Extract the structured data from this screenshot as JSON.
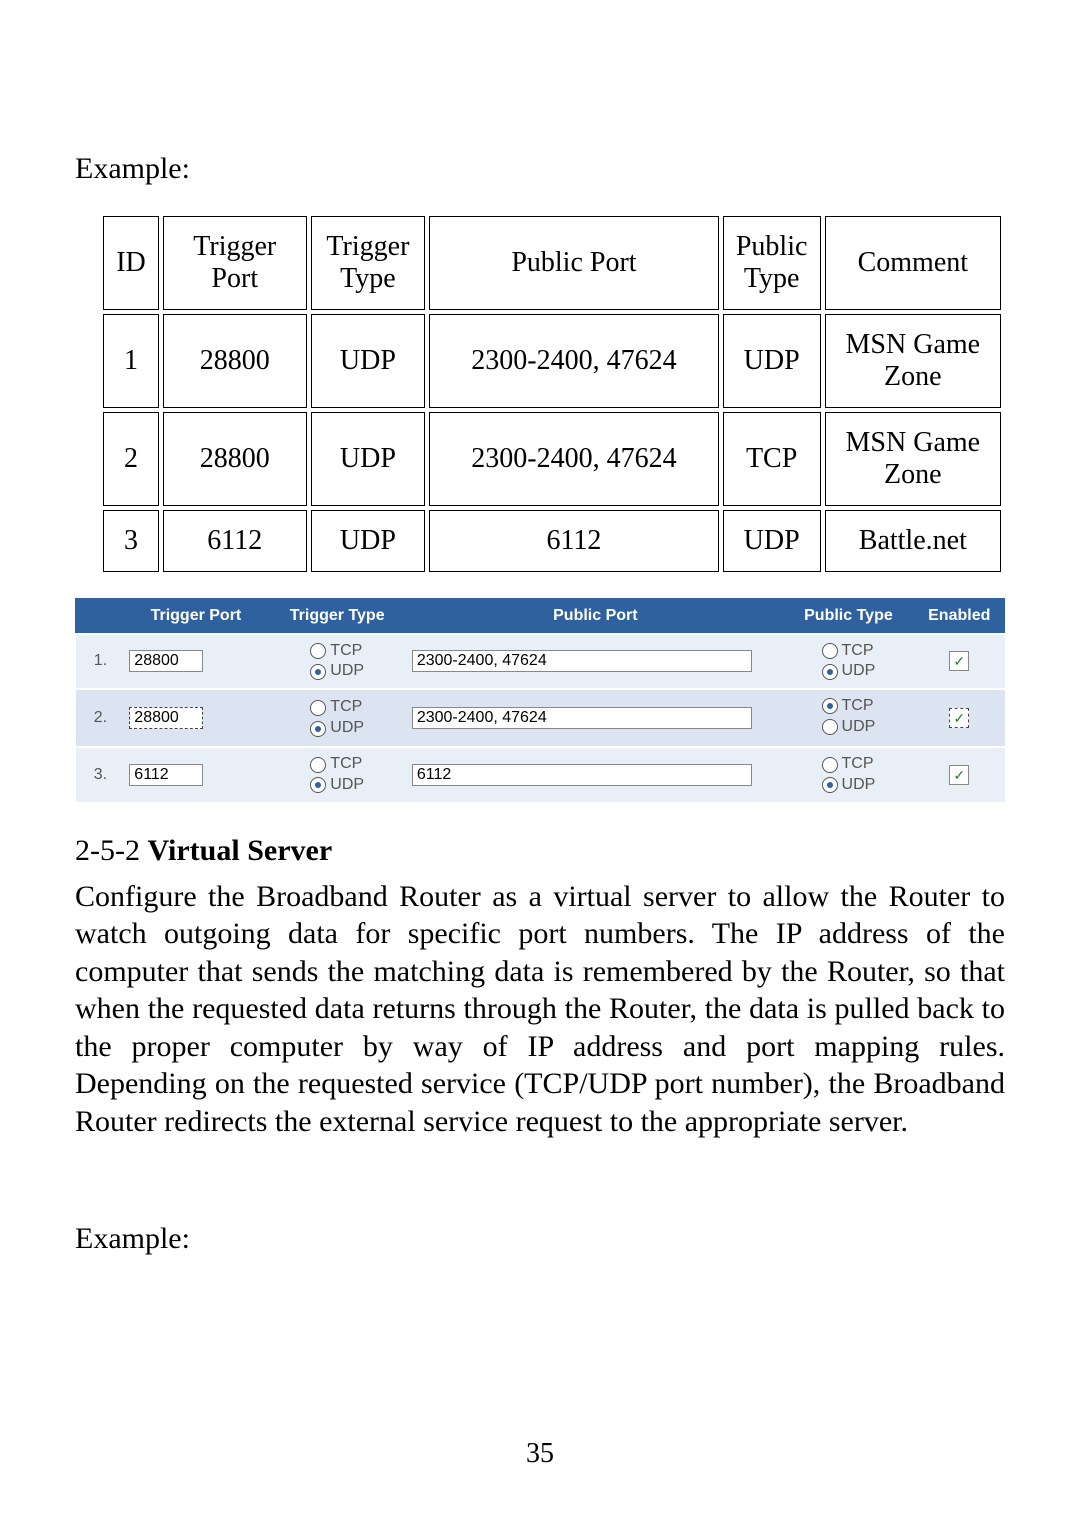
{
  "text": {
    "example": "Example:",
    "example2": "Example:",
    "section_number": "2-5-2",
    "section_title": "Virtual Server",
    "paragraph": "Configure the Broadband Router as a virtual server to allow the Router to watch outgoing data for specific port numbers. The IP address of the computer that sends the matching data is remembered by the Router, so that when the requested data returns through the Router, the data is pulled back to the proper computer by way of IP address and port mapping rules. Depending on the requested service (TCP/UDP port number), the Broadband Router redirects the external service request to the appropriate server.",
    "page_number": "35"
  },
  "example_table": {
    "headers": {
      "id": "ID",
      "trigger_port": "Trigger Port",
      "trigger_type": "Trigger Type",
      "public_port": "Public Port",
      "public_type": "Public Type",
      "comment": "Comment"
    },
    "rows": [
      {
        "id": "1",
        "trigger_port": "28800",
        "trigger_type": "UDP",
        "public_port": "2300-2400, 47624",
        "public_type": "UDP",
        "comment": "MSN Game Zone"
      },
      {
        "id": "2",
        "trigger_port": "28800",
        "trigger_type": "UDP",
        "public_port": "2300-2400, 47624",
        "public_type": "TCP",
        "comment": "MSN Game Zone"
      },
      {
        "id": "3",
        "trigger_port": "6112",
        "trigger_type": "UDP",
        "public_port": "6112",
        "public_type": "UDP",
        "comment": "Battle.net"
      }
    ]
  },
  "ui_table": {
    "headers": {
      "trigger_port": "Trigger Port",
      "trigger_type": "Trigger Type",
      "public_port": "Public Port",
      "public_type": "Public Type",
      "enabled": "Enabled"
    },
    "labels": {
      "tcp": "TCP",
      "udp": "UDP"
    },
    "rows": [
      {
        "id": "1.",
        "trigger_port": "28800",
        "trigger_type": "UDP",
        "public_port": "2300-2400, 47624",
        "public_type": "UDP",
        "enabled": true,
        "enabled_dashed": false,
        "dashed_input": false
      },
      {
        "id": "2.",
        "trigger_port": "28800",
        "trigger_type": "UDP",
        "public_port": "2300-2400, 47624",
        "public_type": "TCP",
        "enabled": true,
        "enabled_dashed": true,
        "dashed_input": true
      },
      {
        "id": "3.",
        "trigger_port": "6112",
        "trigger_type": "UDP",
        "public_port": "6112",
        "public_type": "UDP",
        "enabled": true,
        "enabled_dashed": false,
        "dashed_input": false
      }
    ]
  }
}
